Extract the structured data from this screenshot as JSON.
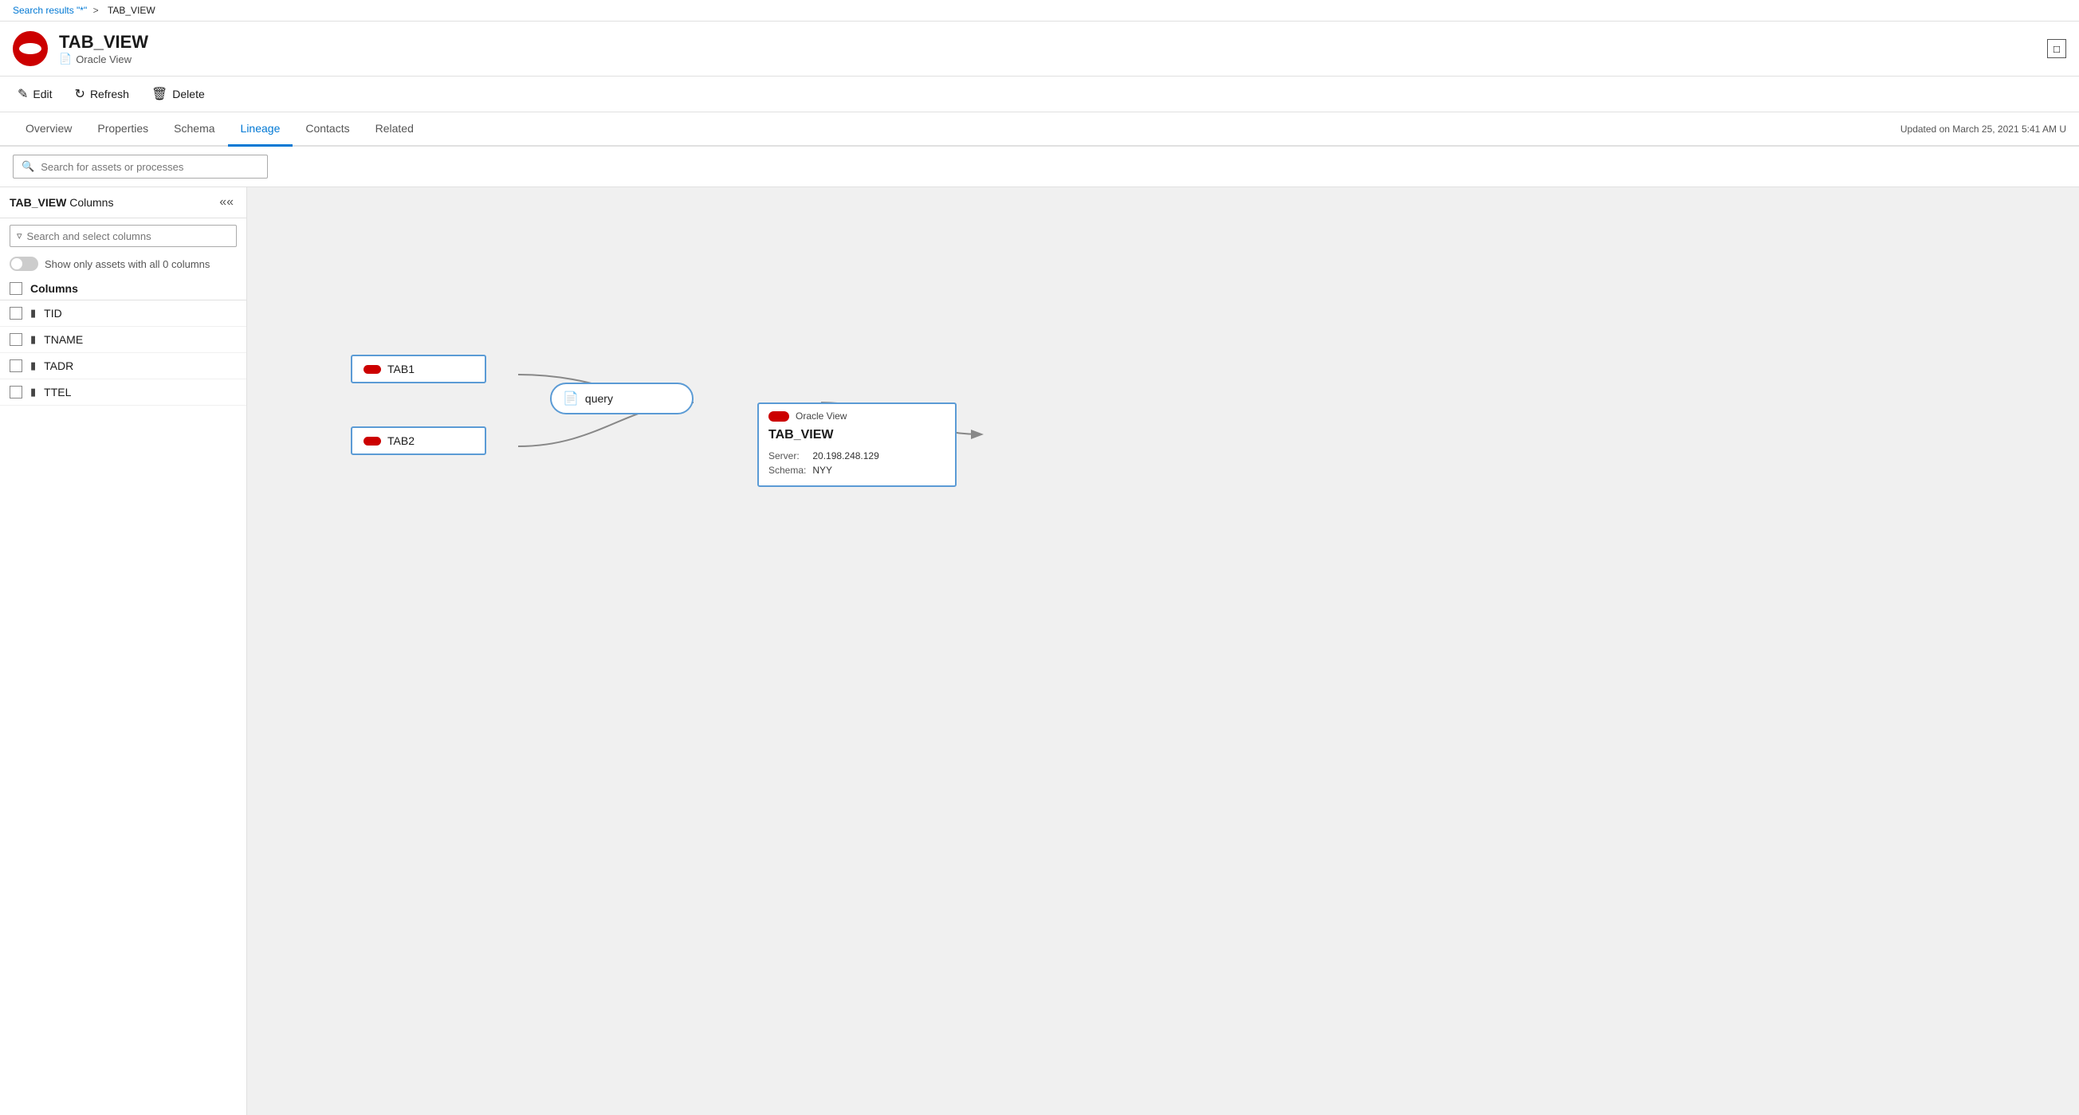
{
  "breadcrumb": {
    "search_label": "Search results \"*\"",
    "separator": ">",
    "current": "TAB_VIEW"
  },
  "asset": {
    "name": "TAB_VIEW",
    "subtitle": "Oracle View",
    "maximize_label": "□"
  },
  "toolbar": {
    "edit_label": "Edit",
    "refresh_label": "Refresh",
    "delete_label": "Delete"
  },
  "tabs": {
    "items": [
      "Overview",
      "Properties",
      "Schema",
      "Lineage",
      "Contacts",
      "Related"
    ],
    "active_index": 3,
    "updated_text": "Updated on March 25, 2021 5:41 AM U"
  },
  "search_bar": {
    "placeholder": "Search for assets or processes"
  },
  "left_panel": {
    "title_bold": "TAB_VIEW",
    "title_rest": " Columns",
    "filter_placeholder": "Search and select columns",
    "toggle_label": "Show only assets with all 0 columns",
    "columns_header": "Columns",
    "columns": [
      {
        "name": "TID"
      },
      {
        "name": "TNAME"
      },
      {
        "name": "TADR"
      },
      {
        "name": "TTEL"
      }
    ]
  },
  "lineage": {
    "node_tab1": "TAB1",
    "node_tab2": "TAB2",
    "node_query": "query",
    "result_type": "Oracle View",
    "result_name": "TAB_VIEW",
    "result_server_label": "Server:",
    "result_server_value": "20.198.248.129",
    "result_schema_label": "Schema:",
    "result_schema_value": "NYY"
  }
}
